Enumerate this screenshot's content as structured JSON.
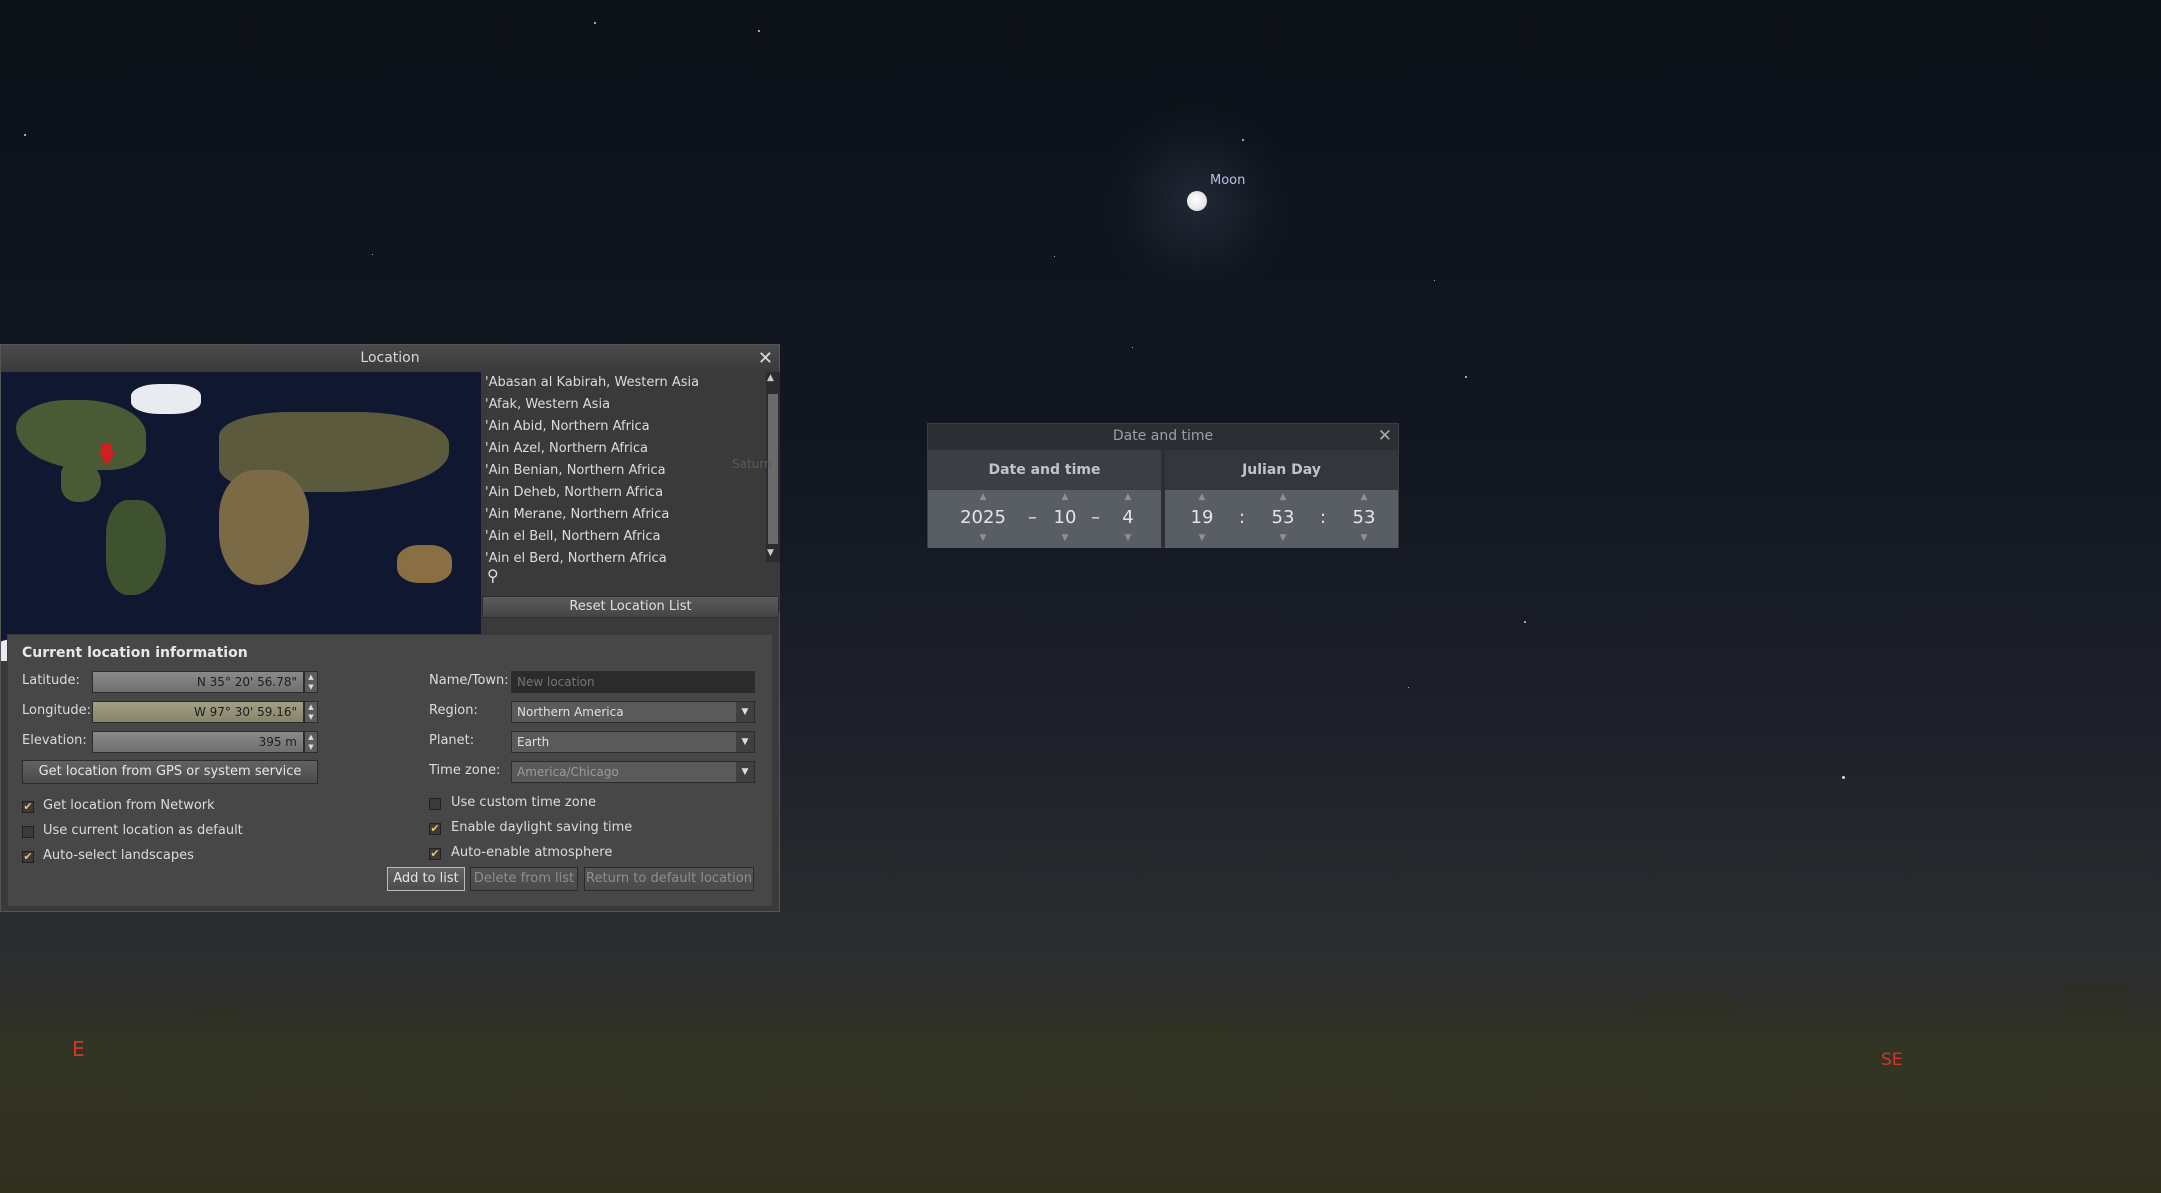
{
  "sky": {
    "moon_label": "Moon",
    "saturn_label": "Saturn",
    "compass": {
      "east": "E",
      "southeast": "SE"
    }
  },
  "location_window": {
    "title": "Location",
    "close_icon": "close-icon",
    "list_items": [
      "'Abasan al Kabirah, Western Asia",
      "'Afak, Western Asia",
      "'Ain Abid, Northern Africa",
      "'Ain Azel, Northern Africa",
      "'Ain Benian, Northern Africa",
      "'Ain Deheb, Northern Africa",
      "'Ain Merane, Northern Africa",
      "'Ain el Bell, Northern Africa",
      "'Ain el Berd, Northern Africa"
    ],
    "reset_button": "Reset Location List",
    "info": {
      "title": "Current location information",
      "latitude_label": "Latitude:",
      "latitude_value": "N 35° 20' 56.78\"",
      "longitude_label": "Longitude:",
      "longitude_value": "W 97° 30' 59.16\"",
      "elevation_label": "Elevation:",
      "elevation_value": "395 m",
      "gps_button": "Get location from GPS or system service",
      "get_from_network": "Get location from Network",
      "use_as_default": "Use current location as default",
      "auto_select_landscapes": "Auto-select landscapes",
      "name_label": "Name/Town:",
      "name_placeholder": "New location",
      "region_label": "Region:",
      "region_value": "Northern America",
      "planet_label": "Planet:",
      "planet_value": "Earth",
      "timezone_label": "Time zone:",
      "timezone_value": "America/Chicago",
      "custom_tz": "Use custom time zone",
      "daylight_saving": "Enable daylight saving time",
      "auto_atmosphere": "Auto-enable atmosphere",
      "add_button": "Add to list",
      "delete_button": "Delete from list",
      "return_button": "Return to default location"
    }
  },
  "datetime_window": {
    "title": "Date and time",
    "tab_date": "Date and time",
    "tab_julian": "Julian Day",
    "year": "2025",
    "month": "10",
    "day": "4",
    "hour": "19",
    "minute": "53",
    "second": "53",
    "date_sep": "–",
    "time_sep": ":"
  }
}
